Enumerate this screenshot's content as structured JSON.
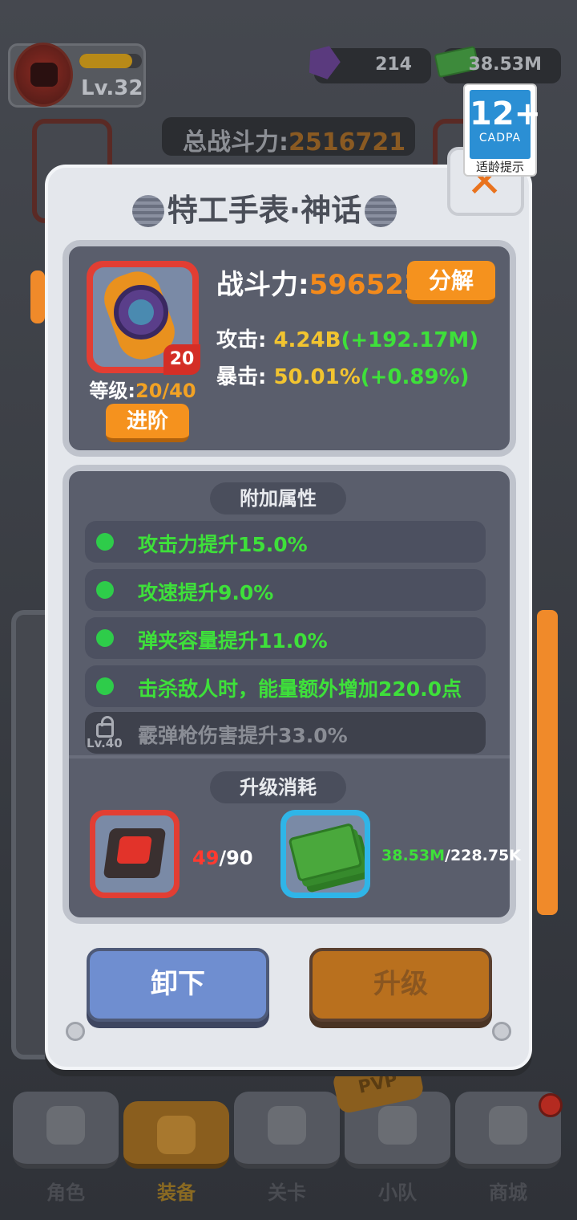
{
  "player": {
    "level": "Lv.32",
    "xp_fraction": 0.85
  },
  "currencies": [
    {
      "name": "gems",
      "icon": "gem-icon",
      "value": "214"
    },
    {
      "name": "cash",
      "icon": "cash-icon",
      "value": "38.53M"
    }
  ],
  "total_power": {
    "label": "总战斗力:",
    "value": "2516721"
  },
  "age_rating": {
    "number": "12+",
    "org": "CADPA",
    "note": "适龄提示"
  },
  "item": {
    "title": "特工手表·神话",
    "level_badge": "20",
    "grade_label": "等级:",
    "grade_value": "20/40",
    "advance_label": "进阶",
    "power_label": "战斗力:",
    "power_value": "596523",
    "decompose_label": "分解",
    "stats": [
      {
        "label": "攻击:",
        "value": "4.24B",
        "bonus": "(+192.17M)"
      },
      {
        "label": "暴击:",
        "value": "50.01%",
        "bonus": "(+0.89%)"
      }
    ]
  },
  "extra_attributes": {
    "heading": "附加属性",
    "items": [
      {
        "text": "攻击力提升15.0%",
        "locked": false
      },
      {
        "text": "攻速提升9.0%",
        "locked": false
      },
      {
        "text": "弹夹容量提升11.0%",
        "locked": false
      },
      {
        "text": "击杀敌人时，能量额外增加220.0点",
        "locked": false
      },
      {
        "text": "霰弹枪伤害提升33.0%",
        "locked": true,
        "unlock_level": "Lv.40"
      }
    ]
  },
  "upgrade_cost": {
    "heading": "升级消耗",
    "items": [
      {
        "icon": "chip-icon",
        "have": "49",
        "need": "/90"
      },
      {
        "icon": "cash-icon",
        "have": "38.53M",
        "need": "/228.75K"
      }
    ]
  },
  "actions": {
    "unequip_label": "卸下",
    "upgrade_label": "升级"
  },
  "bottom_nav": {
    "items": [
      {
        "label": "角色",
        "icon": "skull-icon",
        "active": false
      },
      {
        "label": "装备",
        "icon": "gun-icon",
        "active": true
      },
      {
        "label": "关卡",
        "icon": "map-icon",
        "active": false
      },
      {
        "label": "小队",
        "icon": "team-icon",
        "active": false
      },
      {
        "label": "商城",
        "icon": "shop-icon",
        "active": false
      }
    ],
    "pvp_tag": "PVP"
  },
  "colors": {
    "accent_orange": "#f5921e",
    "stat_green": "#3ee03a",
    "rarity_red": "#e23e33",
    "modal_bg": "#e4e7ec"
  }
}
